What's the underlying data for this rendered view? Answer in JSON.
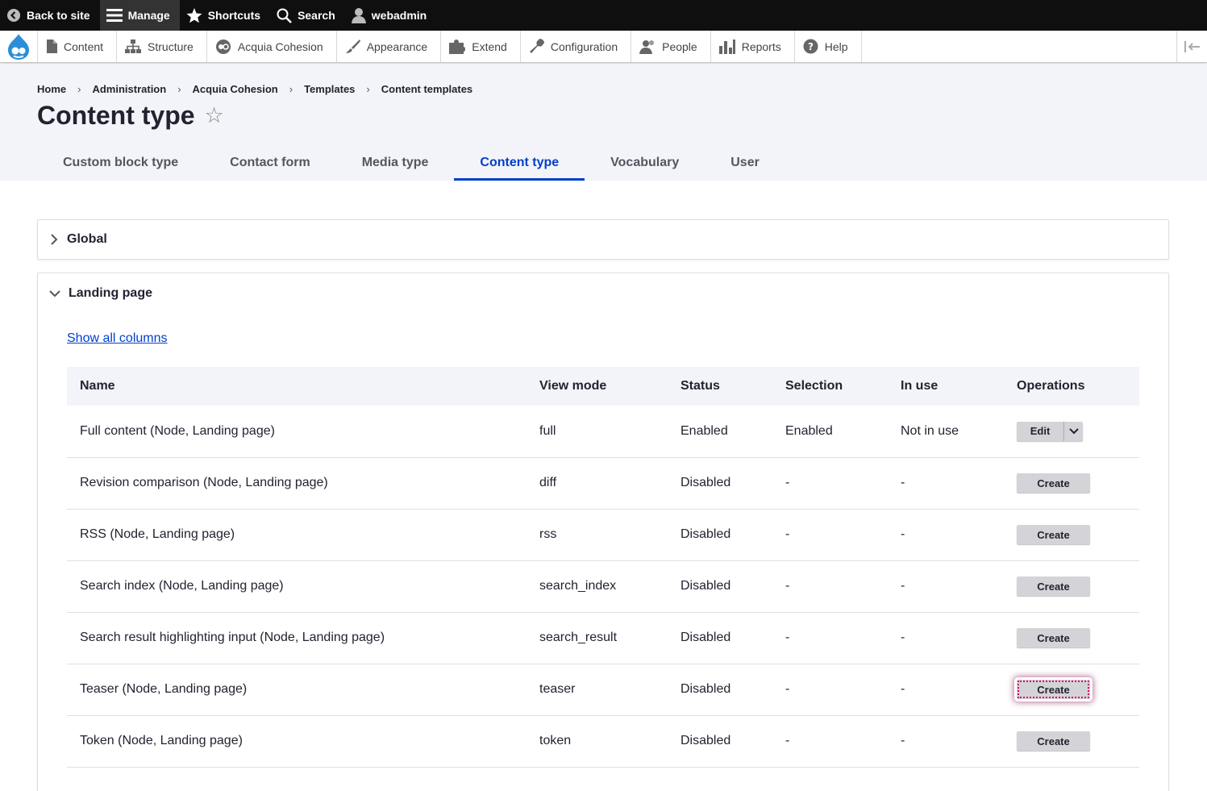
{
  "toolbar": {
    "back_to_site": "Back to site",
    "manage": "Manage",
    "shortcuts": "Shortcuts",
    "search": "Search",
    "user": "webadmin"
  },
  "tray": {
    "items": [
      "Content",
      "Structure",
      "Acquia Cohesion",
      "Appearance",
      "Extend",
      "Configuration",
      "People",
      "Reports",
      "Help"
    ]
  },
  "breadcrumb": [
    "Home",
    "Administration",
    "Acquia Cohesion",
    "Templates",
    "Content templates"
  ],
  "page_title": "Content type",
  "tabs": [
    "Custom block type",
    "Contact form",
    "Media type",
    "Content type",
    "Vocabulary",
    "User"
  ],
  "active_tab": "Content type",
  "sections": {
    "global": "Global",
    "landing": "Landing page",
    "show_all_columns": "Show all columns"
  },
  "table": {
    "headers": [
      "Name",
      "View mode",
      "Status",
      "Selection",
      "In use",
      "Operations"
    ],
    "rows": [
      {
        "name": "Full content (Node, Landing page)",
        "view_mode": "full",
        "status": "Enabled",
        "selection": "Enabled",
        "in_use": "Not in use",
        "operation": "Edit"
      },
      {
        "name": "Revision comparison (Node, Landing page)",
        "view_mode": "diff",
        "status": "Disabled",
        "selection": "-",
        "in_use": "-",
        "operation": "Create"
      },
      {
        "name": "RSS (Node, Landing page)",
        "view_mode": "rss",
        "status": "Disabled",
        "selection": "-",
        "in_use": "-",
        "operation": "Create"
      },
      {
        "name": "Search index (Node, Landing page)",
        "view_mode": "search_index",
        "status": "Disabled",
        "selection": "-",
        "in_use": "-",
        "operation": "Create"
      },
      {
        "name": "Search result highlighting input (Node, Landing page)",
        "view_mode": "search_result",
        "status": "Disabled",
        "selection": "-",
        "in_use": "-",
        "operation": "Create"
      },
      {
        "name": "Teaser (Node, Landing page)",
        "view_mode": "teaser",
        "status": "Disabled",
        "selection": "-",
        "in_use": "-",
        "operation": "Create"
      },
      {
        "name": "Token (Node, Landing page)",
        "view_mode": "token",
        "status": "Disabled",
        "selection": "-",
        "in_use": "-",
        "operation": "Create"
      }
    ]
  },
  "colors": {
    "accent": "#003ecc",
    "focus": "#d6006f",
    "toolbar": "#0f0f0f"
  }
}
